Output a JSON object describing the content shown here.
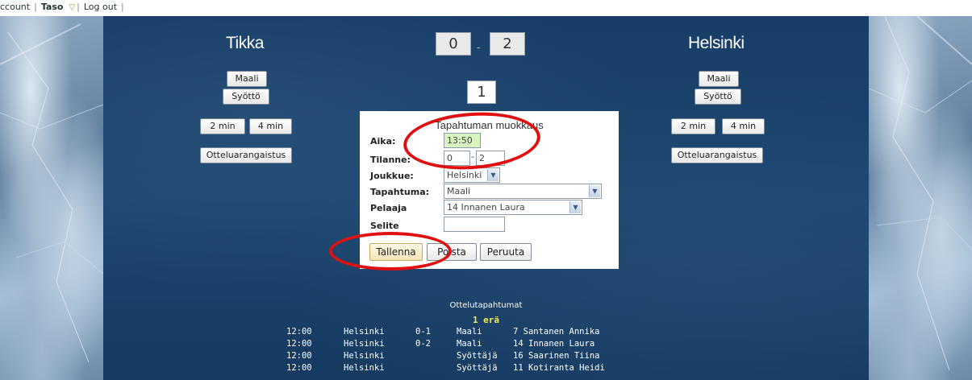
{
  "topbar": {
    "account_label": "ccount",
    "user_name": "Taso",
    "logout_label": "Log out"
  },
  "home": {
    "name": "Tikka",
    "goal_label": "Maali",
    "assist_label": "Syöttö",
    "pen2_label": "2 min",
    "pen4_label": "4 min",
    "match_pen_label": "Otteluarangaistus"
  },
  "away": {
    "name": "Helsinki",
    "goal_label": "Maali",
    "assist_label": "Syöttö",
    "pen2_label": "2 min",
    "pen4_label": "4 min",
    "match_pen_label": "Otteluarangaistus"
  },
  "score": {
    "home": "0",
    "away": "2",
    "separator": "-"
  },
  "period": "1",
  "dialog": {
    "title": "Tapahtuman muokkaus",
    "time_label": "Aika:",
    "time_value": "13:50",
    "situation_label": "Tilanne:",
    "situation_home": "0",
    "situation_sep": "-",
    "situation_away": "2",
    "team_label": "Joukkue:",
    "team_value": "Helsinki",
    "event_label": "Tapahtuma:",
    "event_value": "Maali",
    "player_label": "Pelaaja",
    "player_value": "14 Innanen Laura",
    "note_label": "Selite",
    "note_value": "",
    "save_label": "Tallenna",
    "delete_label": "Poista",
    "cancel_label": "Peruuta"
  },
  "events": {
    "title": "Ottelutapahtumat",
    "period_label": "1 erä",
    "rows": [
      {
        "time": "12:00",
        "team": "Helsinki",
        "score": "0-1",
        "type": "Maali",
        "player": "7 Santanen Annika"
      },
      {
        "time": "12:00",
        "team": "Helsinki",
        "score": "0-2",
        "type": "Maali",
        "player": "14 Innanen Laura"
      },
      {
        "time": "12:00",
        "team": "Helsinki",
        "score": "",
        "type": "Syöttäjä",
        "player": "16 Saarinen Tiina"
      },
      {
        "time": "12:00",
        "team": "Helsinki",
        "score": "",
        "type": "Syöttäjä",
        "player": "11 Kotiranta Heidi"
      }
    ]
  },
  "colors": {
    "annotation": "#e01010",
    "background": "#1c4670",
    "period_text": "#f3e85a"
  }
}
